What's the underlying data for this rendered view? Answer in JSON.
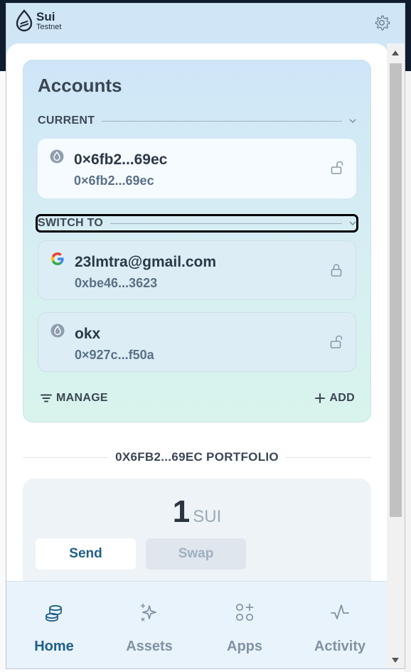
{
  "app": {
    "name": "Sui",
    "network": "Testnet"
  },
  "accounts": {
    "title": "Accounts",
    "current_label": "CURRENT",
    "switch_label": "SWITCH TO",
    "current": {
      "name": "0×6fb2...69ec",
      "address": "0×6fb2...69ec",
      "icon": "sui-icon",
      "locked": false
    },
    "others": [
      {
        "name": "23lmtra@gmail.com",
        "address": "0xbe46...3623",
        "icon": "google-icon",
        "locked": true
      },
      {
        "name": "okx",
        "address": "0×927c...f50a",
        "icon": "sui-icon",
        "locked": false
      }
    ],
    "manage_label": "MANAGE",
    "add_label": "ADD"
  },
  "portfolio": {
    "label": "0X6FB2...69EC PORTFOLIO",
    "balance": "1",
    "unit": "SUI",
    "send_label": "Send",
    "swap_label": "Swap"
  },
  "nav": [
    {
      "label": "Home",
      "icon": "coins-icon",
      "active": true
    },
    {
      "label": "Assets",
      "icon": "sparkles-icon",
      "active": false
    },
    {
      "label": "Apps",
      "icon": "apps-grid-icon",
      "active": false
    },
    {
      "label": "Activity",
      "icon": "activity-icon",
      "active": false
    }
  ],
  "colors": {
    "accent": "#1e5f8b",
    "header_bg": "#cfe6f7",
    "card_gradient_end": "#d8f4ec"
  }
}
